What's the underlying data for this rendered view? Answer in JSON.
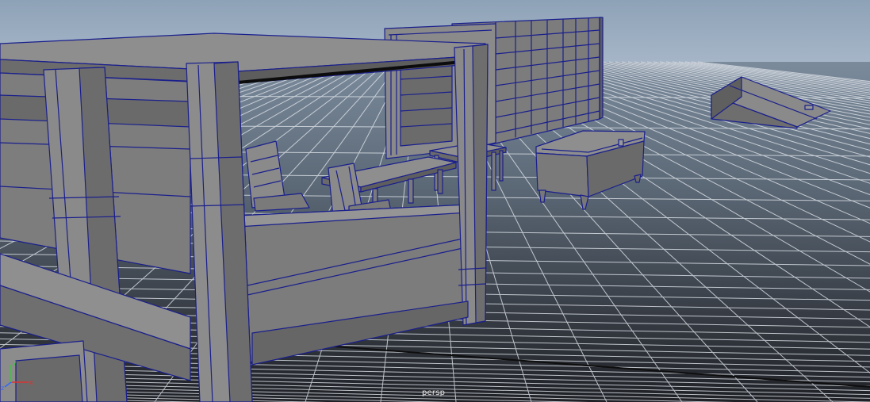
{
  "viewport": {
    "camera_label": "persp",
    "shading_mode": "smooth-shade-with-wireframe",
    "colors": {
      "sky_top": "#8fa3b8",
      "sky_bottom": "#a4b4c6",
      "floor_far": "#6f7f90",
      "floor_near": "#2a2d33",
      "grid_line": "#d9dde3",
      "grid_center": "#111111",
      "mesh_fill": "#7a7a7a",
      "mesh_fill_light": "#8c8c8c",
      "mesh_fill_dark": "#5e5e5e",
      "wireframe": "#1a1f8c"
    }
  },
  "scene_objects": [
    {
      "name": "four-poster-bed"
    },
    {
      "name": "chair-left"
    },
    {
      "name": "chair-right"
    },
    {
      "name": "bench"
    },
    {
      "name": "table"
    },
    {
      "name": "bookshelf"
    },
    {
      "name": "wardrobe-grid"
    },
    {
      "name": "chest"
    },
    {
      "name": "ramp-lid"
    }
  ],
  "axis_indicator": {
    "x_label": "x",
    "y_label": "y",
    "z_label": "z"
  }
}
